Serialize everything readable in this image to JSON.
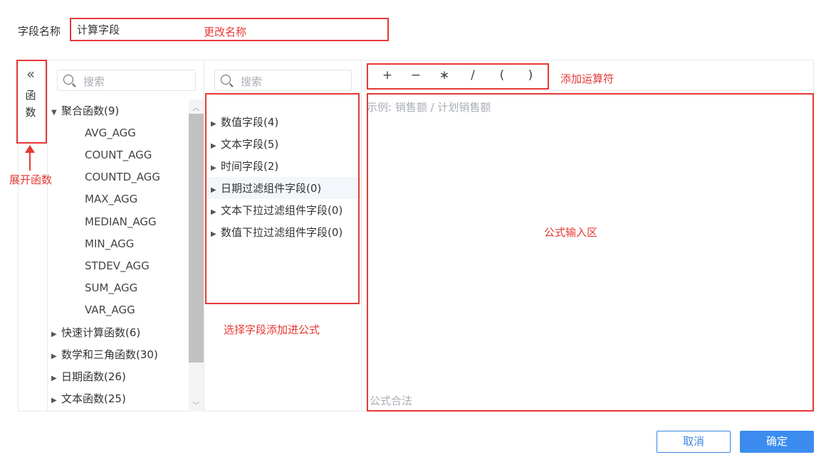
{
  "field_name": {
    "label": "字段名称",
    "value": "计算字段"
  },
  "function_panel": {
    "collapse_label": "函数",
    "search_placeholder": "搜索",
    "groups": [
      {
        "label": "聚合函数(9)",
        "expanded": true,
        "items": [
          "AVG_AGG",
          "COUNT_AGG",
          "COUNTD_AGG",
          "MAX_AGG",
          "MEDIAN_AGG",
          "MIN_AGG",
          "STDEV_AGG",
          "SUM_AGG",
          "VAR_AGG"
        ]
      },
      {
        "label": "快速计算函数(6)",
        "expanded": false
      },
      {
        "label": "数学和三角函数(30)",
        "expanded": false
      },
      {
        "label": "日期函数(26)",
        "expanded": false
      },
      {
        "label": "文本函数(25)",
        "expanded": false
      }
    ]
  },
  "field_panel": {
    "search_placeholder": "搜索",
    "groups": [
      {
        "label": "数值字段(4)"
      },
      {
        "label": "文本字段(5)"
      },
      {
        "label": "时间字段(2)"
      },
      {
        "label": "日期过滤组件字段(0)",
        "highlighted": true
      },
      {
        "label": "文本下拉过滤组件字段(0)"
      },
      {
        "label": "数值下拉过滤组件字段(0)"
      }
    ]
  },
  "operators": [
    "+",
    "−",
    "∗",
    "/",
    "(",
    ")"
  ],
  "formula": {
    "placeholder": "示例: 销售额 / 计划销售额",
    "status": "公式合法"
  },
  "buttons": {
    "cancel": "取消",
    "ok": "确定"
  },
  "annotations": {
    "rename": "更改名称",
    "expand_functions": "展开函数",
    "add_operator": "添加运算符",
    "select_field": "选择字段添加进公式",
    "formula_area": "公式输入区"
  },
  "colors": {
    "annotation_red": "#e53935",
    "primary_blue": "#3c8cf0",
    "placeholder_gray": "#a8adb5"
  }
}
